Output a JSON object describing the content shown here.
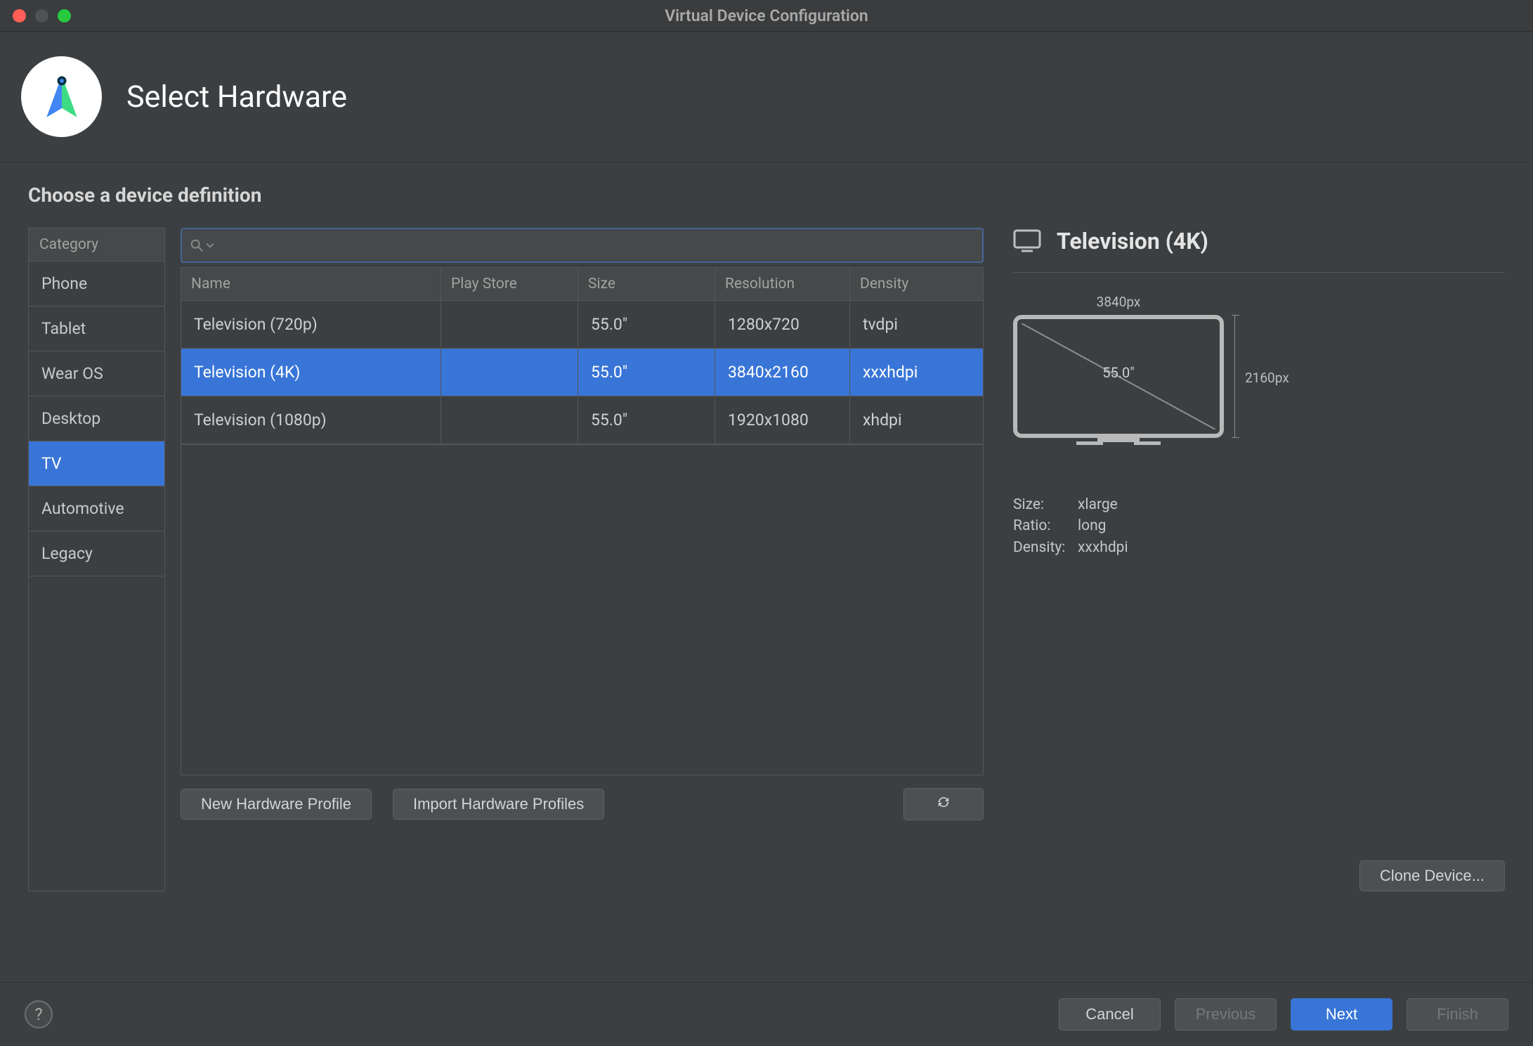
{
  "window": {
    "title": "Virtual Device Configuration"
  },
  "header": {
    "title": "Select Hardware"
  },
  "subtitle": "Choose a device definition",
  "search": {
    "placeholder": ""
  },
  "categories": {
    "header": "Category",
    "items": [
      "Phone",
      "Tablet",
      "Wear OS",
      "Desktop",
      "TV",
      "Automotive",
      "Legacy"
    ],
    "selected_index": 4
  },
  "table": {
    "headers": {
      "name": "Name",
      "play_store": "Play Store",
      "size": "Size",
      "resolution": "Resolution",
      "density": "Density"
    },
    "rows": [
      {
        "name": "Television (720p)",
        "play_store": "",
        "size": "55.0\"",
        "resolution": "1280x720",
        "density": "tvdpi"
      },
      {
        "name": "Television (4K)",
        "play_store": "",
        "size": "55.0\"",
        "resolution": "3840x2160",
        "density": "xxxhdpi"
      },
      {
        "name": "Television (1080p)",
        "play_store": "",
        "size": "55.0\"",
        "resolution": "1920x1080",
        "density": "xhdpi"
      }
    ],
    "selected_index": 1
  },
  "detail": {
    "title": "Television (4K)",
    "width_px": "3840px",
    "height_px": "2160px",
    "diagonal": "55.0\"",
    "specs": {
      "size_label": "Size:",
      "size": "xlarge",
      "ratio_label": "Ratio:",
      "ratio": "long",
      "density_label": "Density:",
      "density": "xxxhdpi"
    }
  },
  "buttons": {
    "new_profile": "New Hardware Profile",
    "import_profiles": "Import Hardware Profiles",
    "clone_device": "Clone Device...",
    "cancel": "Cancel",
    "previous": "Previous",
    "next": "Next",
    "finish": "Finish"
  }
}
